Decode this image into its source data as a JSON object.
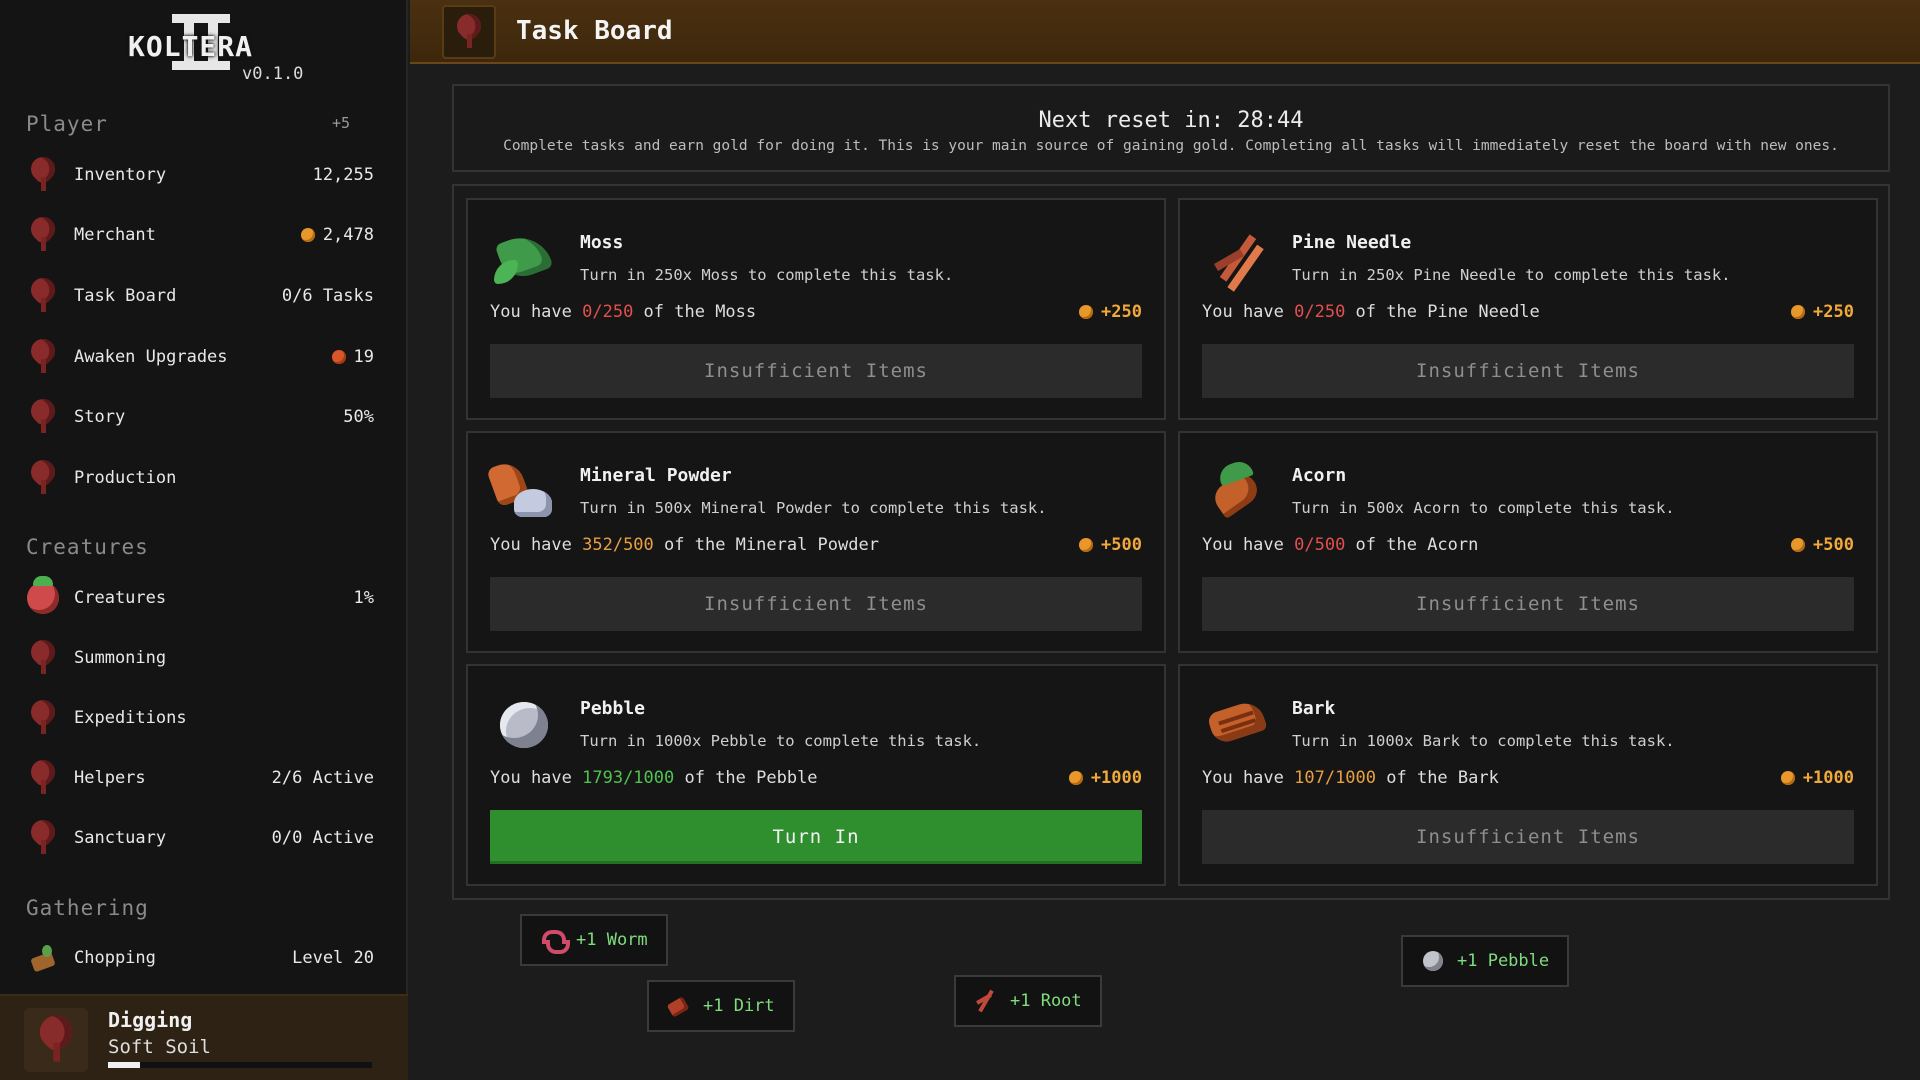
{
  "app": {
    "logo_text": "KOLTERA",
    "version": "v0.1.0"
  },
  "sidebar": {
    "player_section": {
      "title": "Player",
      "badge": "+5"
    },
    "player_items": [
      {
        "label": "Inventory",
        "value": "12,255",
        "icon": "pin-icon"
      },
      {
        "label": "Merchant",
        "value": "2,478",
        "icon": "pin-icon",
        "value_icon": "coin-icon"
      },
      {
        "label": "Task Board",
        "value": "0/6 Tasks",
        "icon": "pin-icon"
      },
      {
        "label": "Awaken Upgrades",
        "value": "19",
        "icon": "pin-icon",
        "value_icon": "orb-icon"
      },
      {
        "label": "Story",
        "value": "50%",
        "icon": "pin-icon"
      },
      {
        "label": "Production",
        "value": "",
        "icon": "pin-icon"
      }
    ],
    "creatures_section": {
      "title": "Creatures"
    },
    "creature_items": [
      {
        "label": "Creatures",
        "value": "1%",
        "icon": "creature-icon"
      },
      {
        "label": "Summoning",
        "value": "",
        "icon": "pin-icon"
      },
      {
        "label": "Expeditions",
        "value": "",
        "icon": "pin-icon"
      },
      {
        "label": "Helpers",
        "value": "2/6 Active",
        "icon": "pin-icon"
      },
      {
        "label": "Sanctuary",
        "value": "0/0 Active",
        "icon": "pin-icon"
      }
    ],
    "gathering_section": {
      "title": "Gathering"
    },
    "gathering_items": [
      {
        "label": "Chopping",
        "value": "Level 20",
        "icon": "chopping-icon"
      }
    ],
    "active_activity": {
      "title": "Digging",
      "subtitle": "Soft Soil",
      "progress": 0.12
    }
  },
  "header": {
    "title": "Task Board",
    "icon": "pin-icon"
  },
  "reset": {
    "label": "Next reset in: 28:44",
    "description": "Complete tasks and earn gold for doing it. This is your main source of gaining gold. Completing all tasks will immediately reset the board with new ones."
  },
  "tasks": [
    {
      "name": "Moss",
      "icon": "moss-icon",
      "description": "Turn in 250x Moss to complete this task.",
      "have_prefix": "You have ",
      "have_qty": "0/250",
      "have_suffix": " of the Moss",
      "qty_status": "red",
      "reward": "+250",
      "button": "Insufficient Items",
      "ready": false
    },
    {
      "name": "Pine Needle",
      "icon": "pine-needle-icon",
      "description": "Turn in 250x Pine Needle to complete this task.",
      "have_prefix": "You have ",
      "have_qty": "0/250",
      "have_suffix": " of the Pine Needle",
      "qty_status": "red",
      "reward": "+250",
      "button": "Insufficient Items",
      "ready": false
    },
    {
      "name": "Mineral Powder",
      "icon": "mineral-powder-icon",
      "description": "Turn in 500x Mineral Powder to complete this task.",
      "have_prefix": "You have ",
      "have_qty": "352/500",
      "have_suffix": " of the Mineral Powder",
      "qty_status": "orange",
      "reward": "+500",
      "button": "Insufficient Items",
      "ready": false
    },
    {
      "name": "Acorn",
      "icon": "acorn-icon",
      "description": "Turn in 500x Acorn to complete this task.",
      "have_prefix": "You have ",
      "have_qty": "0/500",
      "have_suffix": " of the Acorn",
      "qty_status": "red",
      "reward": "+500",
      "button": "Insufficient Items",
      "ready": false
    },
    {
      "name": "Pebble",
      "icon": "pebble-icon",
      "description": "Turn in 1000x Pebble to complete this task.",
      "have_prefix": "You have ",
      "have_qty": "1793/1000",
      "have_suffix": " of the Pebble",
      "qty_status": "green",
      "reward": "+1000",
      "button": "Turn In",
      "ready": true
    },
    {
      "name": "Bark",
      "icon": "bark-icon",
      "description": "Turn in 1000x Bark to complete this task.",
      "have_prefix": "You have ",
      "have_qty": "107/1000",
      "have_suffix": " of the Bark",
      "qty_status": "orange",
      "reward": "+1000",
      "button": "Insufficient Items",
      "ready": false
    }
  ],
  "drops": [
    {
      "label": "+1 Worm",
      "icon": "worm-icon"
    },
    {
      "label": "+1 Dirt",
      "icon": "dirt-icon"
    },
    {
      "label": "+1 Root",
      "icon": "root-icon"
    },
    {
      "label": "+1 Pebble",
      "icon": "pebble-icon"
    }
  ],
  "colors": {
    "accent_gold": "#f0a93a",
    "ready_green": "#2f8f2f",
    "qty_red": "#e0504e",
    "qty_orange": "#e8a040",
    "qty_green": "#4fc24f",
    "header_brown": "#4a3010"
  }
}
